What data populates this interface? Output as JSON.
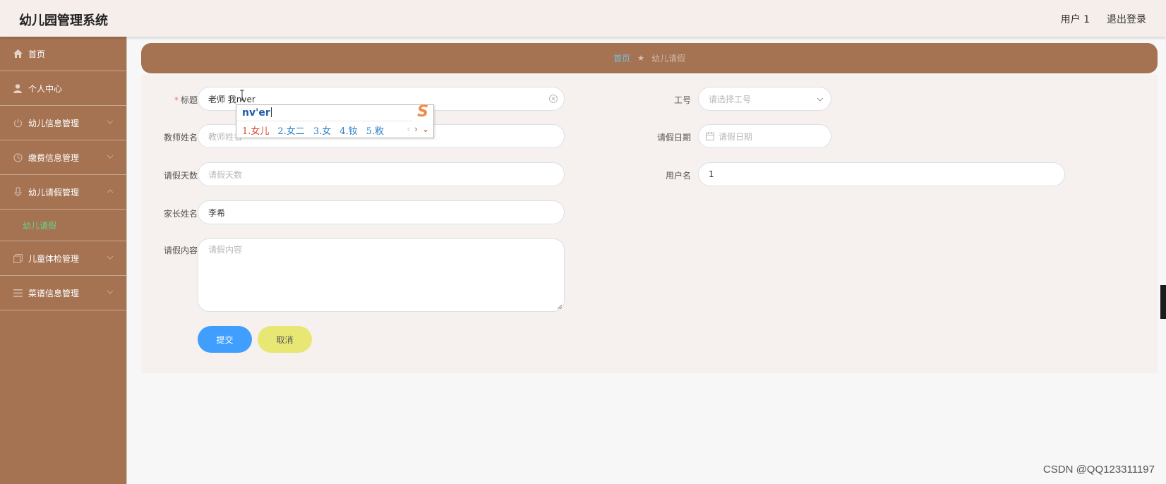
{
  "header": {
    "title": "幼儿园管理系统",
    "user": "用户 1",
    "logout": "退出登录"
  },
  "sidebar": {
    "items": [
      {
        "label": "首页",
        "icon": "home-icon"
      },
      {
        "label": "个人中心",
        "icon": "user-icon"
      },
      {
        "label": "幼儿信息管理",
        "icon": "power-icon"
      },
      {
        "label": "缴费信息管理",
        "icon": "clock-icon"
      },
      {
        "label": "幼儿请假管理",
        "icon": "microphone-icon"
      },
      {
        "label": "儿童体检管理",
        "icon": "copy-icon"
      },
      {
        "label": "菜谱信息管理",
        "icon": "menu-icon"
      }
    ],
    "active_sub": "幼儿请假"
  },
  "breadcrumb": {
    "home": "首页",
    "current": "幼儿请假"
  },
  "form": {
    "title_label": "标题",
    "title_value": "老师 我nver",
    "teacher_name_label": "教师姓名",
    "teacher_name_placeholder": "教师姓名",
    "leave_days_label": "请假天数",
    "leave_days_placeholder": "请假天数",
    "parent_name_label": "家长姓名",
    "parent_name_value": "李希",
    "leave_content_label": "请假内容",
    "leave_content_placeholder": "请假内容",
    "staff_no_label": "工号",
    "staff_no_placeholder": "请选择工号",
    "leave_date_label": "请假日期",
    "leave_date_placeholder": "请假日期",
    "username_label": "用户名",
    "username_value": "1",
    "submit": "提交",
    "cancel": "取消"
  },
  "ime": {
    "composition": "nv'er",
    "candidates": [
      "1.女儿",
      "2.女二",
      "3.女",
      "4.钕",
      "5.敉"
    ]
  },
  "watermark": "CSDN @QQ123311197",
  "colors": {
    "sidebar": "#a57252",
    "header": "#f5eeeb",
    "submit": "#409eff",
    "cancel": "#e9e774",
    "active_sub": "#64d28c"
  }
}
